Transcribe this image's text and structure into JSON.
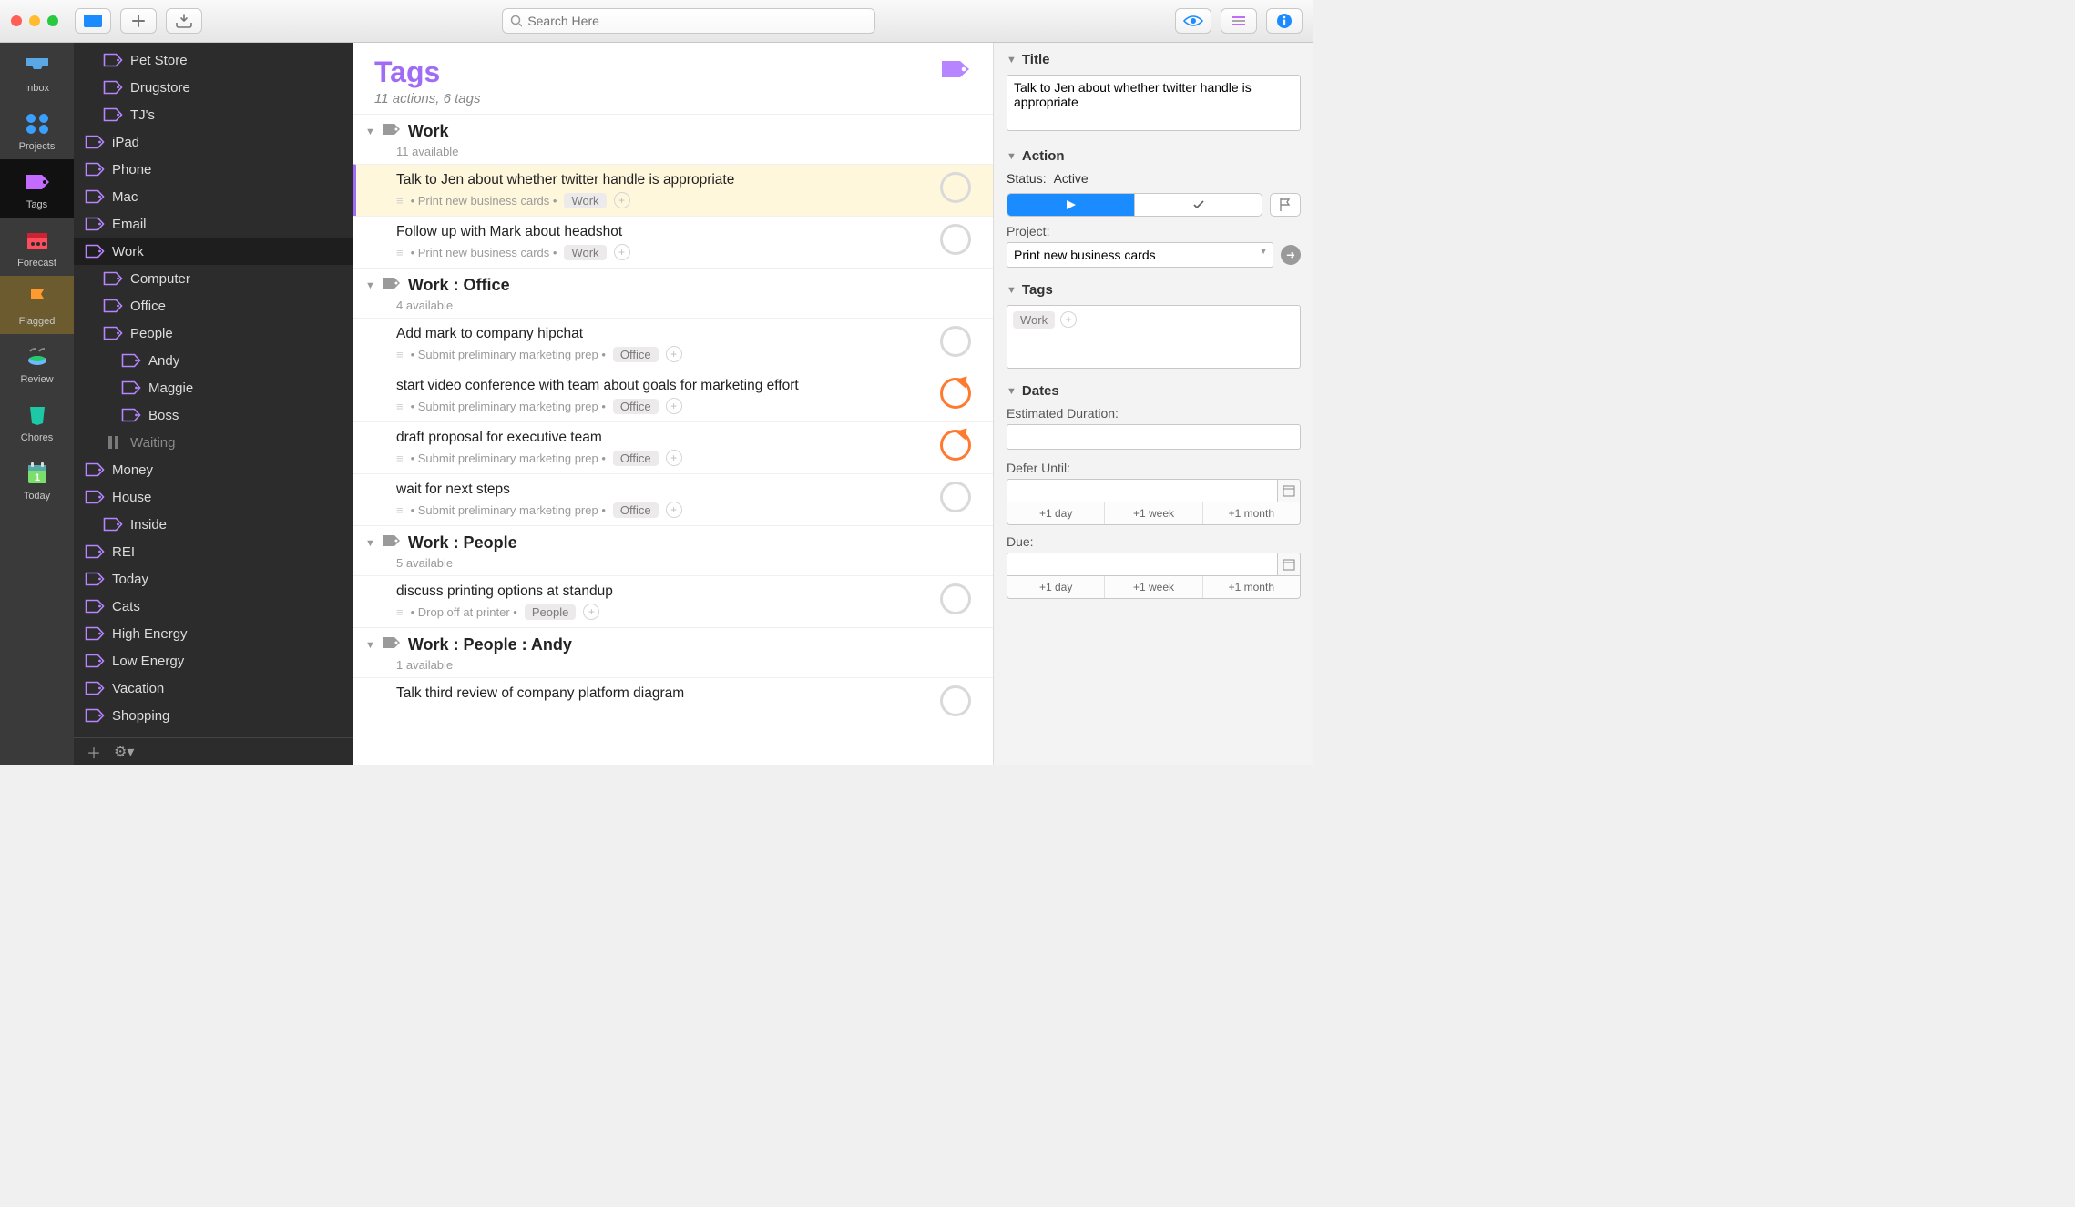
{
  "toolbar": {
    "search_placeholder": "Search Here"
  },
  "perspectives": [
    {
      "id": "inbox",
      "label": "Inbox",
      "color": "#5aa7e6"
    },
    {
      "id": "projects",
      "label": "Projects",
      "color": "#3aa0ff"
    },
    {
      "id": "tags",
      "label": "Tags",
      "color": "#c36bff",
      "sel": true
    },
    {
      "id": "forecast",
      "label": "Forecast",
      "color": "#ff4d5e"
    },
    {
      "id": "flagged",
      "label": "Flagged",
      "color": "#ff9a2e",
      "highlight": true
    },
    {
      "id": "review",
      "label": "Review",
      "color": "#6fb7ff"
    },
    {
      "id": "chores",
      "label": "Chores",
      "color": "#1cc8a5"
    },
    {
      "id": "today",
      "label": "Today",
      "color": "#7be06b"
    }
  ],
  "sidebar": [
    {
      "label": "Pet Store",
      "depth": 1
    },
    {
      "label": "Drugstore",
      "depth": 1
    },
    {
      "label": "TJ's",
      "depth": 1
    },
    {
      "label": "iPad",
      "depth": 0
    },
    {
      "label": "Phone",
      "depth": 0
    },
    {
      "label": "Mac",
      "depth": 0
    },
    {
      "label": "Email",
      "depth": 0
    },
    {
      "label": "Work",
      "depth": 0,
      "sel": true
    },
    {
      "label": "Computer",
      "depth": 1
    },
    {
      "label": "Office",
      "depth": 1
    },
    {
      "label": "People",
      "depth": 1
    },
    {
      "label": "Andy",
      "depth": 2
    },
    {
      "label": "Maggie",
      "depth": 2
    },
    {
      "label": "Boss",
      "depth": 2
    },
    {
      "label": "Waiting",
      "depth": 1,
      "paused": true
    },
    {
      "label": "Money",
      "depth": 0
    },
    {
      "label": "House",
      "depth": 0
    },
    {
      "label": "Inside",
      "depth": 1
    },
    {
      "label": "REI",
      "depth": 0
    },
    {
      "label": "Today",
      "depth": 0
    },
    {
      "label": "Cats",
      "depth": 0
    },
    {
      "label": "High Energy",
      "depth": 0
    },
    {
      "label": "Low Energy",
      "depth": 0
    },
    {
      "label": "Vacation",
      "depth": 0
    },
    {
      "label": "Shopping",
      "depth": 0
    }
  ],
  "main": {
    "title": "Tags",
    "subtitle": "11 actions, 6 tags",
    "sections": [
      {
        "title": "Work",
        "sub": "11 available",
        "tasks": [
          {
            "title": "Talk to Jen about whether twitter handle is appropriate",
            "project": "Print new business cards",
            "tag": "Work",
            "sel": true,
            "status": "open"
          },
          {
            "title": "Follow up with Mark about headshot",
            "project": "Print new business cards",
            "tag": "Work",
            "status": "open"
          }
        ]
      },
      {
        "title": "Work : Office",
        "sub": "4 available",
        "tasks": [
          {
            "title": "Add mark to company hipchat",
            "project": "Submit preliminary marketing prep",
            "tag": "Office",
            "status": "open"
          },
          {
            "title": "start video conference with team about goals for marketing effort",
            "project": "Submit preliminary marketing prep",
            "tag": "Office",
            "status": "repeat"
          },
          {
            "title": "draft proposal for executive team",
            "project": "Submit preliminary marketing prep",
            "tag": "Office",
            "status": "repeat"
          },
          {
            "title": "wait for next steps",
            "project": "Submit preliminary marketing prep",
            "tag": "Office",
            "status": "open"
          }
        ]
      },
      {
        "title": "Work : People",
        "sub": "5 available",
        "tasks": [
          {
            "title": "discuss printing options at standup",
            "project": "Drop off at printer",
            "tag": "People",
            "status": "open"
          }
        ]
      },
      {
        "title": "Work : People : Andy",
        "sub": "1 available",
        "tasks": [
          {
            "title": "Talk third review of company platform diagram",
            "project": "",
            "tag": "",
            "status": "open",
            "nometa": true
          }
        ]
      }
    ]
  },
  "inspector": {
    "title_label": "Title",
    "title_value": "Talk to Jen about whether twitter handle is appropriate",
    "action_label": "Action",
    "status_label": "Status:",
    "status_value": "Active",
    "project_label": "Project:",
    "project_value": "Print new business cards",
    "tags_label": "Tags",
    "tags": [
      "Work"
    ],
    "dates_label": "Dates",
    "estdur_label": "Estimated Duration:",
    "defer_label": "Defer Until:",
    "due_label": "Due:",
    "quick": [
      "+1 day",
      "+1 week",
      "+1 month"
    ]
  }
}
